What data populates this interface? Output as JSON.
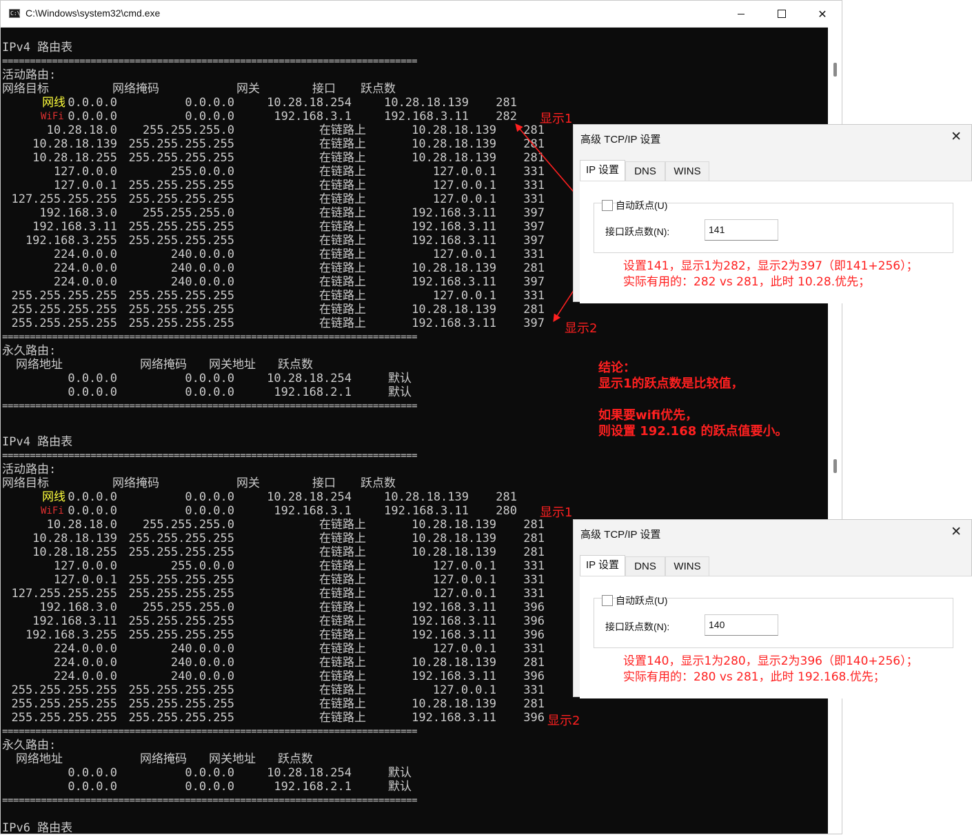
{
  "window": {
    "title": "C:\\Windows\\system32\\cmd.exe",
    "icon_text": "C:\\",
    "minimize": "",
    "maximize": "",
    "close": "✕"
  },
  "colors": {
    "console_bg": "#0c0c0c",
    "console_fg": "#cccccc",
    "annotation_red": "#ff2020",
    "label_yellow": "#ffff3c"
  },
  "route_tables": [
    {
      "title": "IPv4 路由表",
      "separator": "===========================================================================",
      "active_header": "活动路由:",
      "columns": [
        "网络目标",
        "网络掩码",
        "网关",
        "接口",
        "跃点数"
      ],
      "labeled_rows": [
        {
          "label": "网线",
          "dest": "0.0.0.0",
          "mask": "0.0.0.0",
          "gateway": "10.28.18.254",
          "iface": "10.28.18.139",
          "metric": "281"
        },
        {
          "label": "WiFi",
          "dest": "0.0.0.0",
          "mask": "0.0.0.0",
          "gateway": "192.168.3.1",
          "iface": "192.168.3.11",
          "metric": "282"
        }
      ],
      "rows": [
        {
          "dest": "10.28.18.0",
          "mask": "255.255.255.0",
          "gateway": "在链路上",
          "iface": "10.28.18.139",
          "metric": "281"
        },
        {
          "dest": "10.28.18.139",
          "mask": "255.255.255.255",
          "gateway": "在链路上",
          "iface": "10.28.18.139",
          "metric": "281"
        },
        {
          "dest": "10.28.18.255",
          "mask": "255.255.255.255",
          "gateway": "在链路上",
          "iface": "10.28.18.139",
          "metric": "281"
        },
        {
          "dest": "127.0.0.0",
          "mask": "255.0.0.0",
          "gateway": "在链路上",
          "iface": "127.0.0.1",
          "metric": "331"
        },
        {
          "dest": "127.0.0.1",
          "mask": "255.255.255.255",
          "gateway": "在链路上",
          "iface": "127.0.0.1",
          "metric": "331"
        },
        {
          "dest": "127.255.255.255",
          "mask": "255.255.255.255",
          "gateway": "在链路上",
          "iface": "127.0.0.1",
          "metric": "331"
        },
        {
          "dest": "192.168.3.0",
          "mask": "255.255.255.0",
          "gateway": "在链路上",
          "iface": "192.168.3.11",
          "metric": "397"
        },
        {
          "dest": "192.168.3.11",
          "mask": "255.255.255.255",
          "gateway": "在链路上",
          "iface": "192.168.3.11",
          "metric": "397"
        },
        {
          "dest": "192.168.3.255",
          "mask": "255.255.255.255",
          "gateway": "在链路上",
          "iface": "192.168.3.11",
          "metric": "397"
        },
        {
          "dest": "224.0.0.0",
          "mask": "240.0.0.0",
          "gateway": "在链路上",
          "iface": "127.0.0.1",
          "metric": "331"
        },
        {
          "dest": "224.0.0.0",
          "mask": "240.0.0.0",
          "gateway": "在链路上",
          "iface": "10.28.18.139",
          "metric": "281"
        },
        {
          "dest": "224.0.0.0",
          "mask": "240.0.0.0",
          "gateway": "在链路上",
          "iface": "192.168.3.11",
          "metric": "397"
        },
        {
          "dest": "255.255.255.255",
          "mask": "255.255.255.255",
          "gateway": "在链路上",
          "iface": "127.0.0.1",
          "metric": "331"
        },
        {
          "dest": "255.255.255.255",
          "mask": "255.255.255.255",
          "gateway": "在链路上",
          "iface": "10.28.18.139",
          "metric": "281"
        },
        {
          "dest": "255.255.255.255",
          "mask": "255.255.255.255",
          "gateway": "在链路上",
          "iface": "192.168.3.11",
          "metric": "397"
        }
      ],
      "persistent_header": "永久路由:",
      "persistent_columns": [
        "网络地址",
        "网络掩码",
        "网关地址",
        "跃点数"
      ],
      "persistent_rows": [
        {
          "addr": "0.0.0.0",
          "mask": "0.0.0.0",
          "gateway": "10.28.18.254",
          "metric": "默认"
        },
        {
          "addr": "0.0.0.0",
          "mask": "0.0.0.0",
          "gateway": "192.168.2.1",
          "metric": "默认"
        }
      ]
    },
    {
      "title": "IPv4 路由表",
      "separator": "===========================================================================",
      "active_header": "活动路由:",
      "columns": [
        "网络目标",
        "网络掩码",
        "网关",
        "接口",
        "跃点数"
      ],
      "labeled_rows": [
        {
          "label": "网线",
          "dest": "0.0.0.0",
          "mask": "0.0.0.0",
          "gateway": "10.28.18.254",
          "iface": "10.28.18.139",
          "metric": "281"
        },
        {
          "label": "WiFi",
          "dest": "0.0.0.0",
          "mask": "0.0.0.0",
          "gateway": "192.168.3.1",
          "iface": "192.168.3.11",
          "metric": "280"
        }
      ],
      "rows": [
        {
          "dest": "10.28.18.0",
          "mask": "255.255.255.0",
          "gateway": "在链路上",
          "iface": "10.28.18.139",
          "metric": "281"
        },
        {
          "dest": "10.28.18.139",
          "mask": "255.255.255.255",
          "gateway": "在链路上",
          "iface": "10.28.18.139",
          "metric": "281"
        },
        {
          "dest": "10.28.18.255",
          "mask": "255.255.255.255",
          "gateway": "在链路上",
          "iface": "10.28.18.139",
          "metric": "281"
        },
        {
          "dest": "127.0.0.0",
          "mask": "255.0.0.0",
          "gateway": "在链路上",
          "iface": "127.0.0.1",
          "metric": "331"
        },
        {
          "dest": "127.0.0.1",
          "mask": "255.255.255.255",
          "gateway": "在链路上",
          "iface": "127.0.0.1",
          "metric": "331"
        },
        {
          "dest": "127.255.255.255",
          "mask": "255.255.255.255",
          "gateway": "在链路上",
          "iface": "127.0.0.1",
          "metric": "331"
        },
        {
          "dest": "192.168.3.0",
          "mask": "255.255.255.0",
          "gateway": "在链路上",
          "iface": "192.168.3.11",
          "metric": "396"
        },
        {
          "dest": "192.168.3.11",
          "mask": "255.255.255.255",
          "gateway": "在链路上",
          "iface": "192.168.3.11",
          "metric": "396"
        },
        {
          "dest": "192.168.3.255",
          "mask": "255.255.255.255",
          "gateway": "在链路上",
          "iface": "192.168.3.11",
          "metric": "396"
        },
        {
          "dest": "224.0.0.0",
          "mask": "240.0.0.0",
          "gateway": "在链路上",
          "iface": "127.0.0.1",
          "metric": "331"
        },
        {
          "dest": "224.0.0.0",
          "mask": "240.0.0.0",
          "gateway": "在链路上",
          "iface": "10.28.18.139",
          "metric": "281"
        },
        {
          "dest": "224.0.0.0",
          "mask": "240.0.0.0",
          "gateway": "在链路上",
          "iface": "192.168.3.11",
          "metric": "396"
        },
        {
          "dest": "255.255.255.255",
          "mask": "255.255.255.255",
          "gateway": "在链路上",
          "iface": "127.0.0.1",
          "metric": "331"
        },
        {
          "dest": "255.255.255.255",
          "mask": "255.255.255.255",
          "gateway": "在链路上",
          "iface": "10.28.18.139",
          "metric": "281"
        },
        {
          "dest": "255.255.255.255",
          "mask": "255.255.255.255",
          "gateway": "在链路上",
          "iface": "192.168.3.11",
          "metric": "396"
        }
      ],
      "persistent_header": "永久路由:",
      "persistent_columns": [
        "网络地址",
        "网络掩码",
        "网关地址",
        "跃点数"
      ],
      "persistent_rows": [
        {
          "addr": "0.0.0.0",
          "mask": "0.0.0.0",
          "gateway": "10.28.18.254",
          "metric": "默认"
        },
        {
          "addr": "0.0.0.0",
          "mask": "0.0.0.0",
          "gateway": "192.168.2.1",
          "metric": "默认"
        }
      ]
    }
  ],
  "ipv6_title": "IPv6 路由表",
  "annotations": {
    "display1": "显示1",
    "display2": "显示2",
    "conclusion": [
      "结论：",
      "显示1的跃点数是比较值，",
      "",
      "如果要wifi优先，",
      "则设置 192.168 的跃点值要小。"
    ]
  },
  "dialogs": [
    {
      "title": "高级 TCP/IP 设置",
      "close": "✕",
      "tabs": [
        "IP 设置",
        "DNS",
        "WINS"
      ],
      "auto_metric_label": "自动跃点(U)",
      "metric_label": "接口跃点数(N):",
      "metric_value": "141",
      "note": [
        "设置141，显示1为282，显示2为397（即141+256）；",
        "实际有用的：282 vs 281，此时 10.28.优先；"
      ]
    },
    {
      "title": "高级 TCP/IP 设置",
      "close": "✕",
      "tabs": [
        "IP 设置",
        "DNS",
        "WINS"
      ],
      "auto_metric_label": "自动跃点(U)",
      "metric_label": "接口跃点数(N):",
      "metric_value": "140",
      "note": [
        "设置140，显示1为280，显示2为396（即140+256）；",
        "实际有用的：280 vs 281，此时 192.168.优先；"
      ]
    }
  ]
}
